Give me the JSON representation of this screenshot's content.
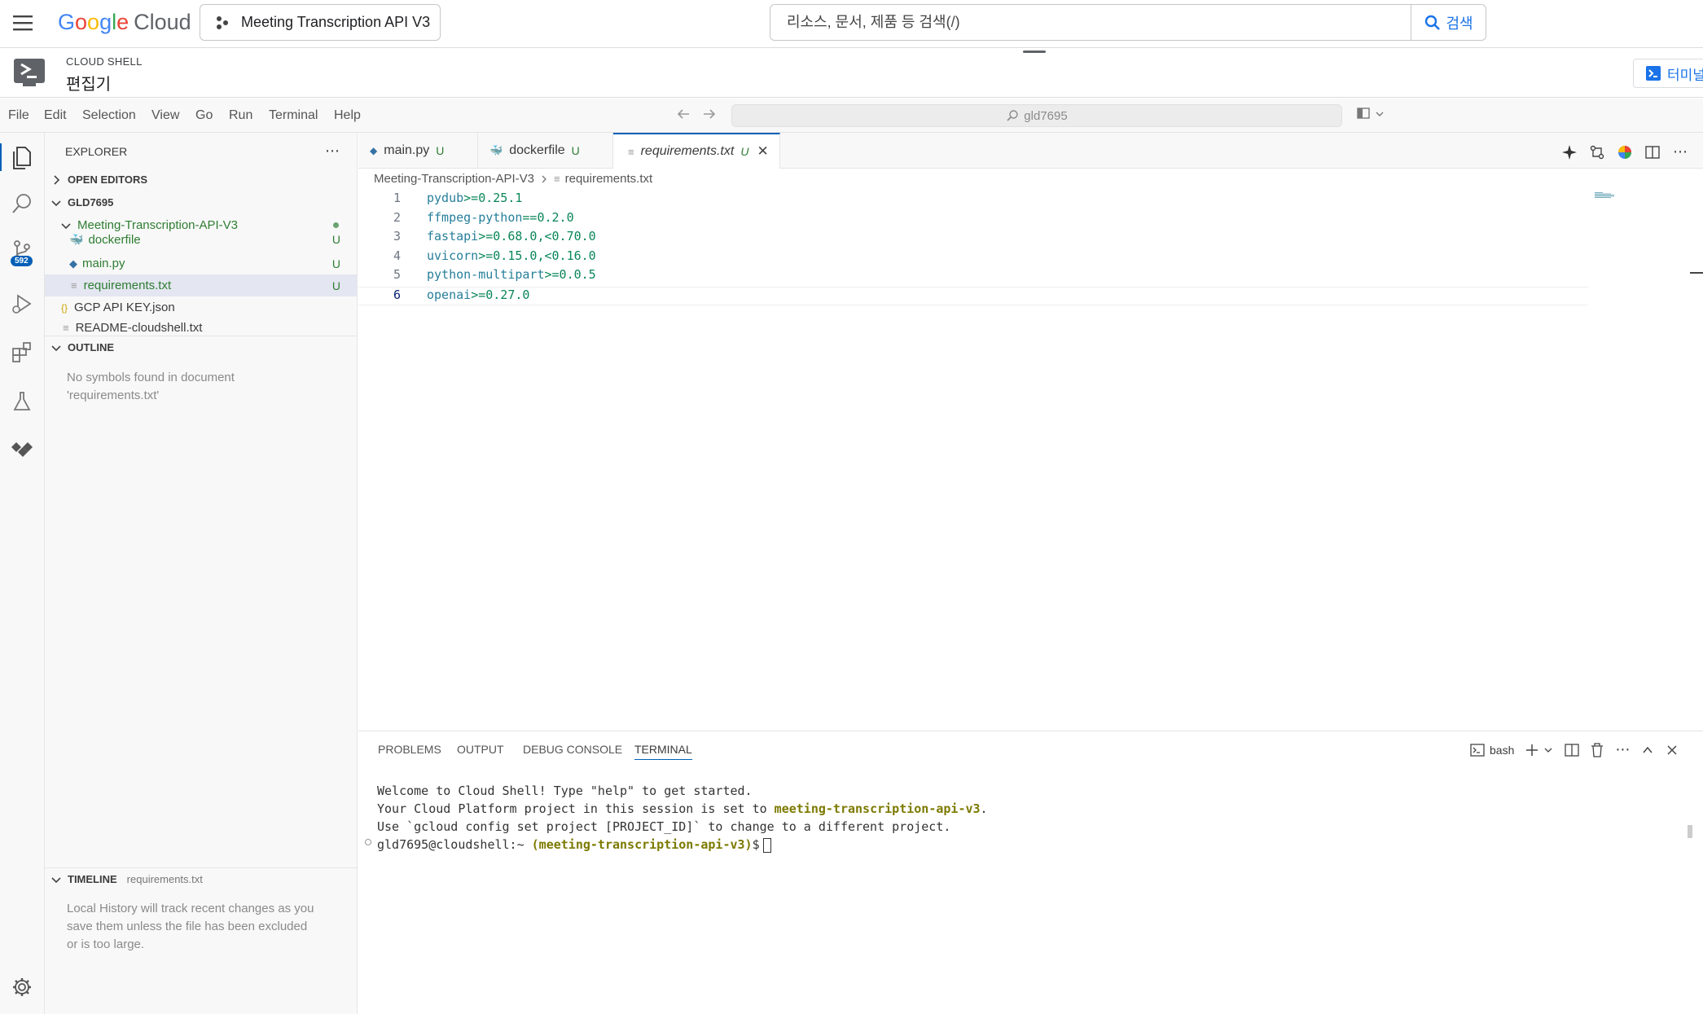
{
  "topbar": {
    "logo_google": [
      "G",
      "o",
      "o",
      "g",
      "l",
      "e"
    ],
    "logo_cloud": "Cloud",
    "project_label": "Meeting Transcription API V3",
    "search_placeholder": "리소스, 문서, 제품 등 검색(/)",
    "search_button": "검색"
  },
  "shell": {
    "small_label": "CLOUD SHELL",
    "title": "편집기",
    "open_terminal_label": "터미널"
  },
  "menu": {
    "items": [
      "File",
      "Edit",
      "Selection",
      "View",
      "Go",
      "Run",
      "Terminal",
      "Help"
    ],
    "command_center": "gld7695"
  },
  "activity": {
    "scm_badge": "592"
  },
  "sidebar": {
    "explorer_title": "EXPLORER",
    "open_editors": "OPEN EDITORS",
    "workspace": "GLD7695",
    "folder": "Meeting-Transcription-API-V3",
    "files": [
      {
        "name": "dockerfile",
        "status": "U"
      },
      {
        "name": "main.py",
        "status": "U"
      },
      {
        "name": "requirements.txt",
        "status": "U"
      }
    ],
    "root_files": [
      "GCP API KEY.json",
      "README-cloudshell.txt"
    ],
    "outline_title": "OUTLINE",
    "outline_note_1": "No symbols found in document",
    "outline_note_2": "'requirements.txt'",
    "timeline_title": "TIMELINE",
    "timeline_file": "requirements.txt",
    "timeline_note": [
      "Local History will track recent changes as you",
      "save them unless the file has been excluded",
      "or is too large."
    ]
  },
  "tabs": [
    {
      "label": "main.py",
      "status": "U"
    },
    {
      "label": "dockerfile",
      "status": "U"
    },
    {
      "label": "requirements.txt",
      "status": "U"
    }
  ],
  "breadcrumb": {
    "folder": "Meeting-Transcription-API-V3",
    "file": "requirements.txt"
  },
  "code_lines": [
    {
      "n": "1",
      "pkg": "pydub",
      "spec": ">=0.25.1"
    },
    {
      "n": "2",
      "pkg": "ffmpeg-python",
      "spec": "==0.2.0"
    },
    {
      "n": "3",
      "pkg": "fastapi",
      "spec": ">=0.68.0,<0.70.0"
    },
    {
      "n": "4",
      "pkg": "uvicorn",
      "spec": ">=0.15.0,<0.16.0"
    },
    {
      "n": "5",
      "pkg": "python-multipart",
      "spec": ">=0.0.5"
    },
    {
      "n": "6",
      "pkg": "openai",
      "spec": ">=0.27.0"
    }
  ],
  "panel": {
    "tabs": [
      "PROBLEMS",
      "OUTPUT",
      "DEBUG CONSOLE",
      "TERMINAL"
    ],
    "shell_name": "bash",
    "terminal": {
      "line1": "Welcome to Cloud Shell! Type \"help\" to get started.",
      "line2_prefix": "Your Cloud Platform project in this session is set to ",
      "line2_project": "meeting-transcription-api-v3",
      "line2_suffix": ".",
      "line3": "Use `gcloud config set project [PROJECT_ID]` to change to a different project.",
      "prompt_user": "gld7695@cloudshell:~ ",
      "prompt_project": "(meeting-transcription-api-v3)",
      "prompt_end": "$"
    }
  },
  "colors": {
    "accent": "#005fb8",
    "google_blue": "#1a73e8",
    "untracked_green": "#2e7d32",
    "terminal_highlight": "#7c7a00"
  }
}
